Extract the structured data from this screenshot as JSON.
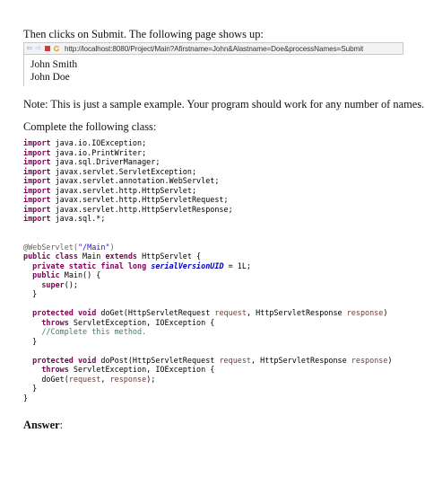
{
  "intro_text": "Then clicks on Submit. The following page shows up:",
  "browser": {
    "icons": [
      "back-arrow-icon",
      "forward-arrow-icon",
      "stop-icon",
      "refresh-icon"
    ],
    "url": "http://localhost:8080/Project/Main?Afirstname=John&Alastname=Doe&processNames=Submit",
    "output_lines": [
      "John Smith",
      "John Doe"
    ]
  },
  "note_text": "Note: This is just a sample example. Your program should work for any number of names.",
  "instruction_text": "Complete the following class:",
  "imports": [
    "java.io.IOException;",
    "java.io.PrintWriter;",
    "java.sql.DriverManager;",
    "javax.servlet.ServletException;",
    "javax.servlet.annotation.WebServlet;",
    "javax.servlet.http.HttpServlet;",
    "javax.servlet.http.HttpServletRequest;",
    "javax.servlet.http.HttpServletResponse;",
    "java.sql.*;"
  ],
  "code_lines": [
    [
      {
        "t": "@WebServlet(",
        "c": "ann"
      },
      {
        "t": "\"/Main\"",
        "c": "str"
      },
      {
        "t": ")",
        "c": "ann"
      }
    ],
    [
      {
        "t": "public class ",
        "c": "kw"
      },
      {
        "t": "Main "
      },
      {
        "t": "extends ",
        "c": "kw"
      },
      {
        "t": "HttpServlet {"
      }
    ],
    [
      {
        "t": "  "
      },
      {
        "t": "private static final long ",
        "c": "kw"
      },
      {
        "t": "serialVersionUID",
        "c": "fld"
      },
      {
        "t": " = 1L;"
      }
    ],
    [
      {
        "t": "  "
      },
      {
        "t": "public ",
        "c": "kw"
      },
      {
        "t": "Main() {"
      }
    ],
    [
      {
        "t": "    "
      },
      {
        "t": "super",
        "c": "kw"
      },
      {
        "t": "();"
      }
    ],
    [
      {
        "t": "  }"
      }
    ],
    [
      {
        "t": ""
      }
    ],
    [
      {
        "t": "  "
      },
      {
        "t": "protected void ",
        "c": "kw"
      },
      {
        "t": "doGet(HttpServletRequest "
      },
      {
        "t": "request",
        "c": "prm"
      },
      {
        "t": ", HttpServletResponse "
      },
      {
        "t": "response",
        "c": "prm"
      },
      {
        "t": ")"
      }
    ],
    [
      {
        "t": "    "
      },
      {
        "t": "throws ",
        "c": "kw"
      },
      {
        "t": "ServletException, IOException {"
      }
    ],
    [
      {
        "t": "    "
      },
      {
        "t": "//Complete this method.",
        "c": "cmt"
      }
    ],
    [
      {
        "t": "  }"
      }
    ],
    [
      {
        "t": ""
      }
    ],
    [
      {
        "t": "  "
      },
      {
        "t": "protected void ",
        "c": "kw"
      },
      {
        "t": "doPost(HttpServletRequest "
      },
      {
        "t": "request",
        "c": "prm"
      },
      {
        "t": ", HttpServletResponse "
      },
      {
        "t": "response",
        "c": "prm"
      },
      {
        "t": ")"
      }
    ],
    [
      {
        "t": "    "
      },
      {
        "t": "throws ",
        "c": "kw"
      },
      {
        "t": "ServletException, IOException {"
      }
    ],
    [
      {
        "t": "    "
      },
      {
        "t": "doGet("
      },
      {
        "t": "request",
        "c": "prm"
      },
      {
        "t": ", "
      },
      {
        "t": "response",
        "c": "prm"
      },
      {
        "t": ");"
      }
    ],
    [
      {
        "t": "  }"
      }
    ],
    [
      {
        "t": "}"
      }
    ]
  ],
  "import_keyword": "import",
  "answer_label": "Answer",
  "answer_suffix": ":",
  "colors": {
    "keyword": "#7f0055",
    "annotation": "#646464",
    "string": "#2a00ff",
    "static_field": "#0000c0",
    "parameter": "#6a3e3e",
    "comment": "#3f7f5f"
  }
}
